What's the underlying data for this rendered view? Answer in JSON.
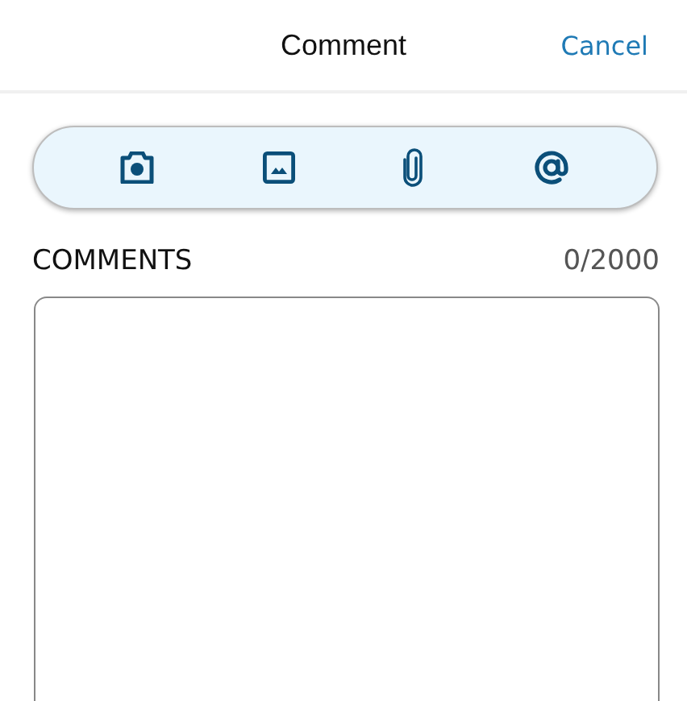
{
  "header": {
    "title": "Comment",
    "cancel": "Cancel"
  },
  "comments": {
    "label": "COMMENTS",
    "count": "0/2000"
  }
}
